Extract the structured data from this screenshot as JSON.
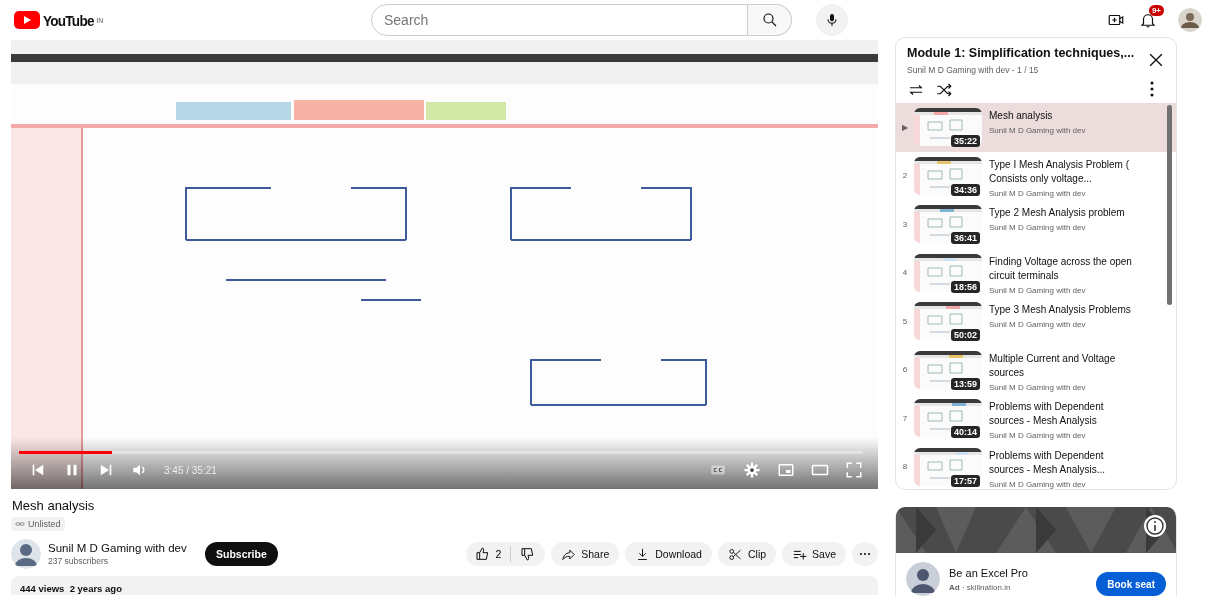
{
  "header": {
    "logo": "YouTube",
    "region": "IN",
    "search": {
      "placeholder": "Search"
    },
    "notifications": "9+"
  },
  "player": {
    "playing": true,
    "progress": {
      "level": 0.11
    },
    "time": "3:45 / 35:21"
  },
  "video": {
    "title": "Mesh analysis",
    "visibility": "Unlisted",
    "channel": "Sunil M D Gaming with dev",
    "subscribers": "237 subscribers",
    "subscribe": "Subscribe",
    "likes": "2",
    "actions": [
      {
        "kind": "share",
        "label": "Share"
      },
      {
        "kind": "download",
        "label": "Download"
      },
      {
        "kind": "clip",
        "label": "Clip"
      },
      {
        "kind": "save",
        "label": "Save"
      }
    ],
    "description": "444 views  2 years ago"
  },
  "playlist": {
    "title": "Module 1: Simplification techniques,...",
    "subtitle": "Sunil M D Gaming with dev - 1 / 15",
    "items": [
      {
        "index": "▶",
        "selected": true,
        "title": "Mesh analysis",
        "channel": "Sunil M D Gaming with dev",
        "duration": "35:22"
      },
      {
        "index": "2",
        "selected": false,
        "title": "Type I Mesh Analysis Problem ( Consists only voltage...",
        "channel": "Sunil M D Gaming with dev",
        "duration": "34:36"
      },
      {
        "index": "3",
        "selected": false,
        "title": "Type 2 Mesh Analysis problem",
        "channel": "Sunil M D Gaming with dev",
        "duration": "36:41"
      },
      {
        "index": "4",
        "selected": false,
        "title": "Finding Voltage across the open circuit terminals",
        "channel": "Sunil M D Gaming with dev",
        "duration": "18:56"
      },
      {
        "index": "5",
        "selected": false,
        "title": "Type 3 Mesh Analysis Problems",
        "channel": "Sunil M D Gaming with dev",
        "duration": "50:02"
      },
      {
        "index": "6",
        "selected": false,
        "title": "Multiple Current and Voltage sources",
        "channel": "Sunil M D Gaming with dev",
        "duration": "13:59"
      },
      {
        "index": "7",
        "selected": false,
        "title": "Problems with Dependent sources - Mesh Analysis",
        "channel": "Sunil M D Gaming with dev",
        "duration": "40:14"
      },
      {
        "index": "8",
        "selected": false,
        "title": "Problems with Dependent sources - Mesh Analysis...",
        "channel": "Sunil M D Gaming with dev",
        "duration": "17:57"
      }
    ]
  },
  "ad": {
    "title": "Be an Excel Pro",
    "meta": "**Ad** · skillnation.in",
    "button": "Book seat"
  }
}
